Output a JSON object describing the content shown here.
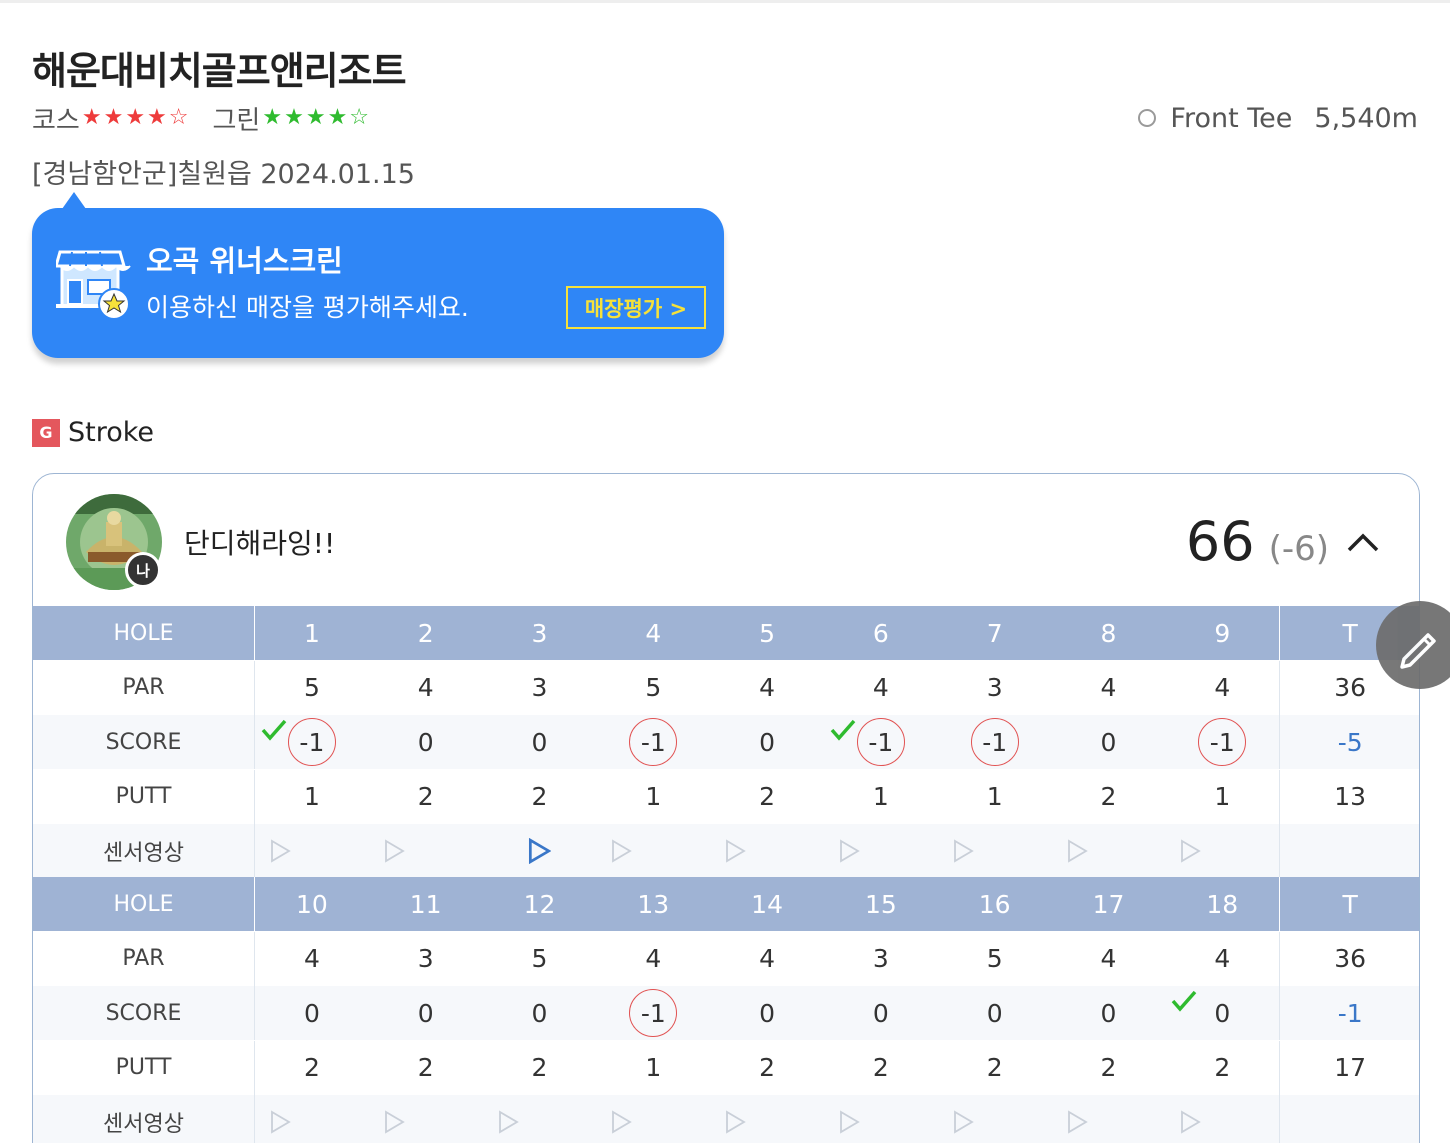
{
  "course": {
    "title": "해운대비치골프앤리조트",
    "course_label": "코스",
    "course_stars": 4,
    "green_label": "그린",
    "green_stars": 4,
    "tee_name": "Front Tee",
    "tee_distance": "5,540m",
    "location_date": "[경남함안군]칠원읍 2024.01.15"
  },
  "banner": {
    "title": "오곡 위너스크린",
    "subtitle": "이용하신 매장을 평가해주세요.",
    "button_label": "매장평가 >",
    "bg_color": "#2f86f6",
    "button_color": "#f6e13a"
  },
  "mode": {
    "badge": "G",
    "label": "Stroke"
  },
  "player": {
    "me_badge": "나",
    "name": "단디해라잉!!",
    "total": "66",
    "diff": "(-6)"
  },
  "labels": {
    "hole": "HOLE",
    "par": "PAR",
    "score": "SCORE",
    "putt": "PUTT",
    "video": "센서영상",
    "total": "T"
  },
  "front": {
    "holes": [
      "1",
      "2",
      "3",
      "4",
      "5",
      "6",
      "7",
      "8",
      "9"
    ],
    "par": [
      "5",
      "4",
      "3",
      "5",
      "4",
      "4",
      "3",
      "4",
      "4"
    ],
    "par_total": "36",
    "score": [
      "-1",
      "0",
      "0",
      "-1",
      "0",
      "-1",
      "-1",
      "0",
      "-1"
    ],
    "score_total": "-5",
    "putt": [
      "1",
      "2",
      "2",
      "1",
      "2",
      "1",
      "1",
      "2",
      "1"
    ],
    "putt_total": "13",
    "checks": [
      1,
      6
    ],
    "active_video": 3
  },
  "back": {
    "holes": [
      "10",
      "11",
      "12",
      "13",
      "14",
      "15",
      "16",
      "17",
      "18"
    ],
    "par": [
      "4",
      "3",
      "5",
      "4",
      "4",
      "3",
      "5",
      "4",
      "4"
    ],
    "par_total": "36",
    "score": [
      "0",
      "0",
      "0",
      "-1",
      "0",
      "0",
      "0",
      "0",
      "0"
    ],
    "score_total": "-1",
    "putt": [
      "2",
      "2",
      "2",
      "1",
      "2",
      "2",
      "2",
      "2",
      "2"
    ],
    "putt_total": "17",
    "checks": [
      18
    ],
    "active_video": 0
  },
  "colors": {
    "header_row": "#9fb3d4",
    "birdie_circle": "#e15353",
    "check": "#2fbb2f",
    "negative_total": "#3a77c8"
  },
  "icons": [
    "store-icon",
    "chevron-up-icon",
    "check-icon",
    "play-icon",
    "pencil-icon",
    "tee-circle-icon",
    "star-icon"
  ]
}
